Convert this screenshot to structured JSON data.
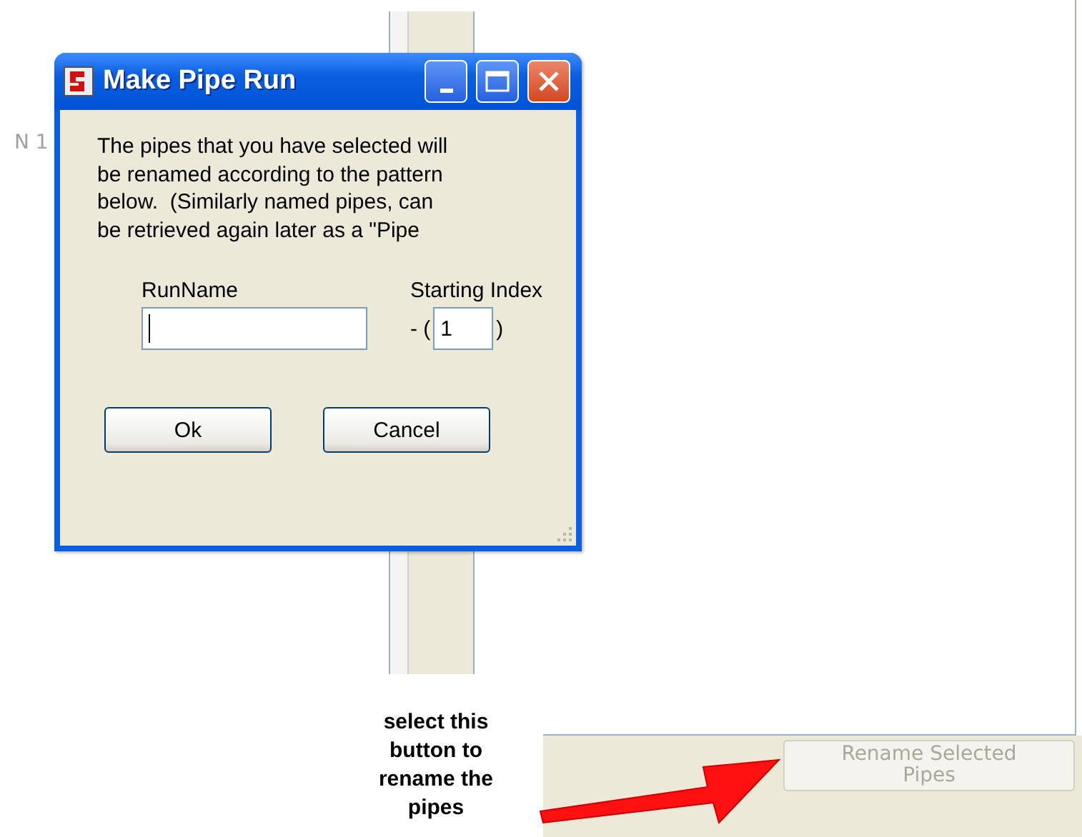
{
  "background": {
    "node_label": "N 1",
    "rename_button": {
      "label": "Rename Selected Pipes",
      "disabled": true
    }
  },
  "dialog": {
    "title": "Make Pipe Run",
    "message": "The pipes that you have selected will\nbe renamed according to the pattern\nbelow.  (Similarly named pipes, can\nbe retrieved again later as a \"Pipe",
    "run_name": {
      "label": "RunName",
      "focused": true
    },
    "starting_index": {
      "label": "Starting Index",
      "prefix": "- (",
      "value": "1",
      "suffix": ")"
    },
    "buttons": [
      "Ok",
      "Cancel"
    ]
  },
  "annotation": {
    "text": "select this\nbutton to\nrename the\npipes"
  }
}
